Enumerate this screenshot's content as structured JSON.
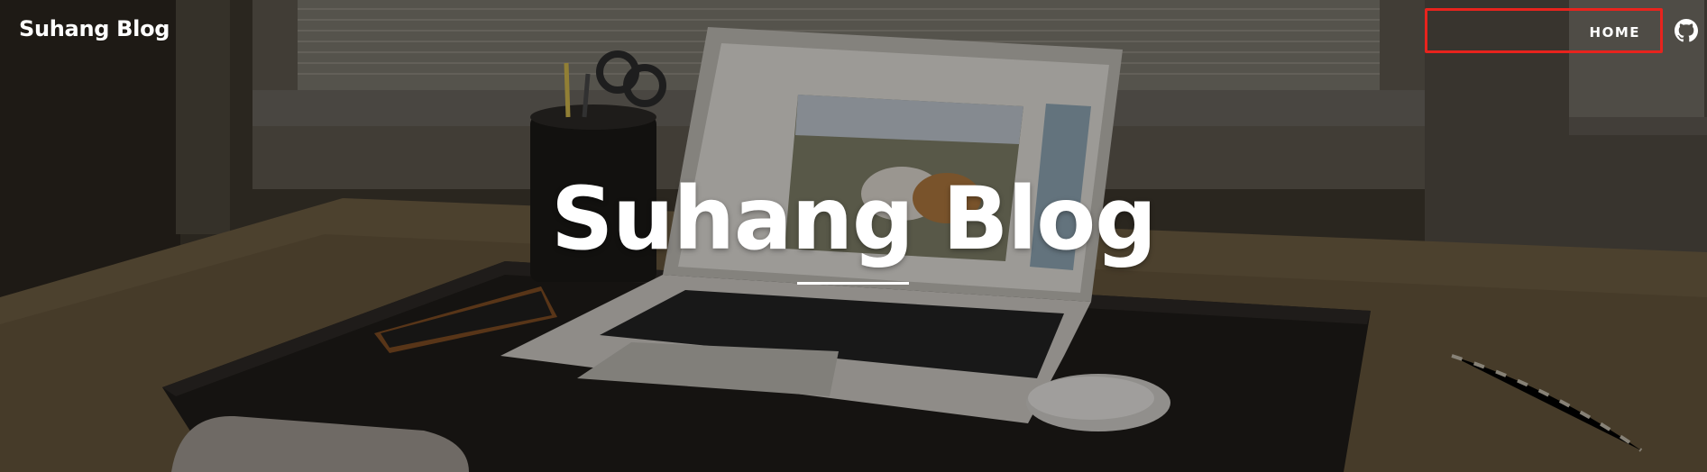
{
  "navbar": {
    "brand": "Suhang Blog",
    "home_label": "HOME",
    "github_icon": "github-icon"
  },
  "hero": {
    "title": "Suhang Blog",
    "background": "desk-with-laptop-photo"
  },
  "colors": {
    "highlight_box": "#e8231d",
    "text": "#ffffff"
  }
}
